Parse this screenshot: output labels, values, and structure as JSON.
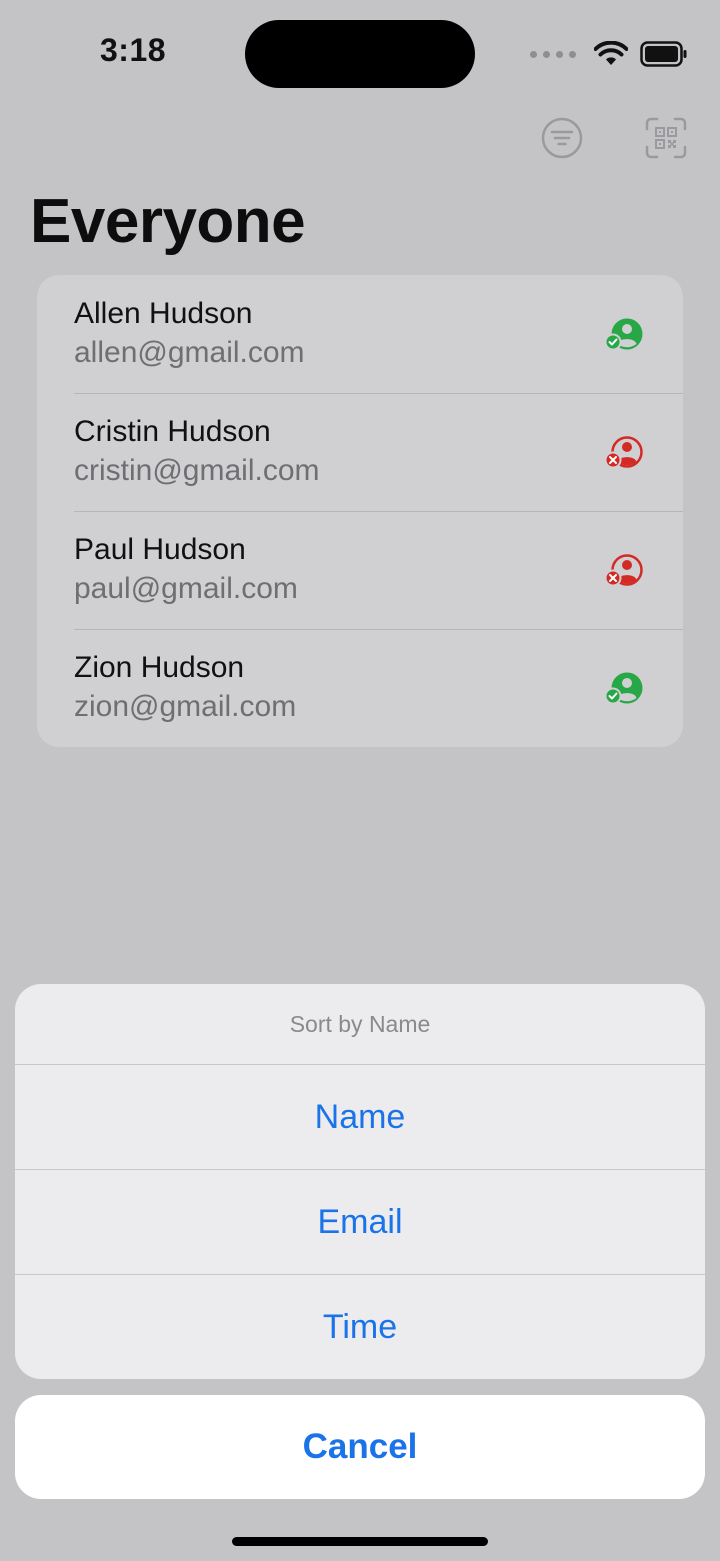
{
  "status_bar": {
    "time": "3:18"
  },
  "header": {
    "title": "Everyone",
    "icons": [
      "filter-icon",
      "qr-scan-icon"
    ]
  },
  "contacts": [
    {
      "name": "Allen Hudson",
      "email": "allen@gmail.com",
      "status": "verified",
      "status_color": "#27a745"
    },
    {
      "name": "Cristin Hudson",
      "email": "cristin@gmail.com",
      "status": "rejected",
      "status_color": "#d42a25"
    },
    {
      "name": "Paul Hudson",
      "email": "paul@gmail.com",
      "status": "rejected",
      "status_color": "#d42a25"
    },
    {
      "name": "Zion Hudson",
      "email": "zion@gmail.com",
      "status": "verified",
      "status_color": "#27a745"
    }
  ],
  "action_sheet": {
    "title": "Sort by Name",
    "options": [
      "Name",
      "Email",
      "Time"
    ],
    "cancel": "Cancel"
  },
  "colors": {
    "accent": "#1a73e8",
    "verified": "#27a745",
    "rejected": "#d42a25"
  }
}
